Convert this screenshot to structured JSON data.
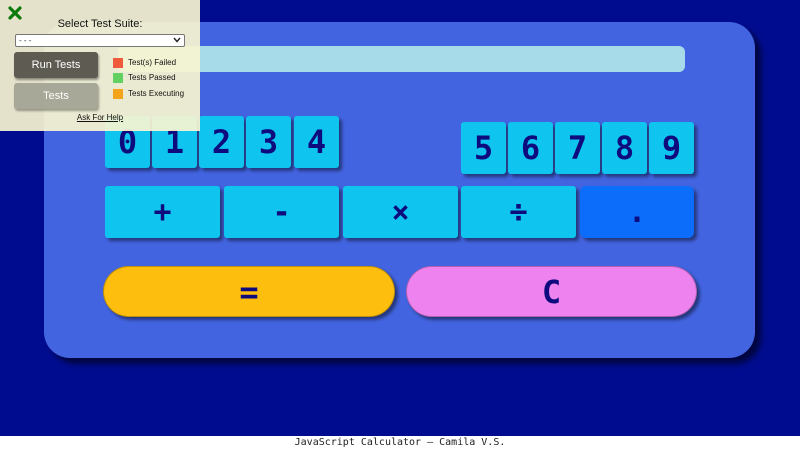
{
  "calculator": {
    "digits_left": [
      "0",
      "1",
      "2",
      "3",
      "4"
    ],
    "digits_right": [
      "5",
      "6",
      "7",
      "8",
      "9"
    ],
    "operators": [
      "+",
      "-",
      "×",
      "÷",
      "."
    ],
    "equals_label": "=",
    "clear_label": "C",
    "display_value": ""
  },
  "footer": {
    "text": "JavaScript Calculator – Camila V.S."
  },
  "test_panel": {
    "title": "Select Test Suite:",
    "suite_select": {
      "selected": "- - -"
    },
    "run_button_label": "Run Tests",
    "tests_button_label": "Tests",
    "legend": [
      {
        "label": "Test(s) Failed",
        "color": "#f05a3c"
      },
      {
        "label": "Tests Passed",
        "color": "#62d162"
      },
      {
        "label": "Tests Executing",
        "color": "#f5a31b"
      }
    ],
    "help_link_label": "Ask For Help"
  },
  "colors": {
    "background": "#000c8f",
    "calculator_body": "#4364e0",
    "key": "#0fc5ef",
    "decimal_key": "#0d6dfb",
    "equals_key": "#fdbe0d",
    "clear_key": "#ee82ee",
    "close_icon": "#0b7a0b"
  }
}
